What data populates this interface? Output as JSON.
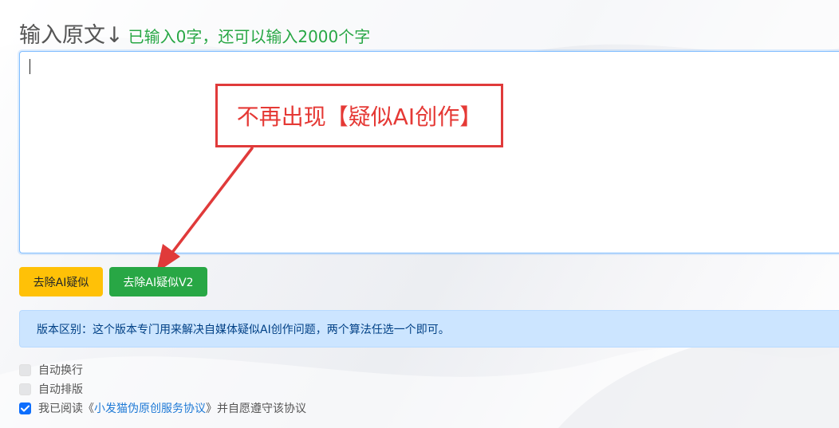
{
  "header": {
    "title": "输入原文↓",
    "char_count_text": "已输入0字，还可以输入2000个字"
  },
  "editor": {
    "value": "",
    "placeholder": ""
  },
  "annotation": {
    "callout_text": "不再出现【疑似AI创作】"
  },
  "buttons": {
    "remove_ai_label": "去除AI疑似",
    "remove_ai_v2_label": "去除AI疑似V2"
  },
  "info": {
    "text": "版本区别：这个版本专门用来解决自媒体疑似AI创作问题，两个算法任选一个即可。"
  },
  "options": {
    "auto_wrap": {
      "label": "自动换行",
      "checked": false
    },
    "auto_layout": {
      "label": "自动排版",
      "checked": false
    },
    "agreement": {
      "checked": true,
      "prefix": "我已阅读《",
      "link_text": "小发猫伪原创服务协议",
      "suffix": "》并自愿遵守该协议"
    }
  },
  "colors": {
    "accent_blue": "#80bdff",
    "warning_yellow": "#ffc107",
    "success_green": "#28a745",
    "annotation_red": "#e03a3a",
    "info_bg": "#cce5ff",
    "link_blue": "#1f7ad6"
  }
}
